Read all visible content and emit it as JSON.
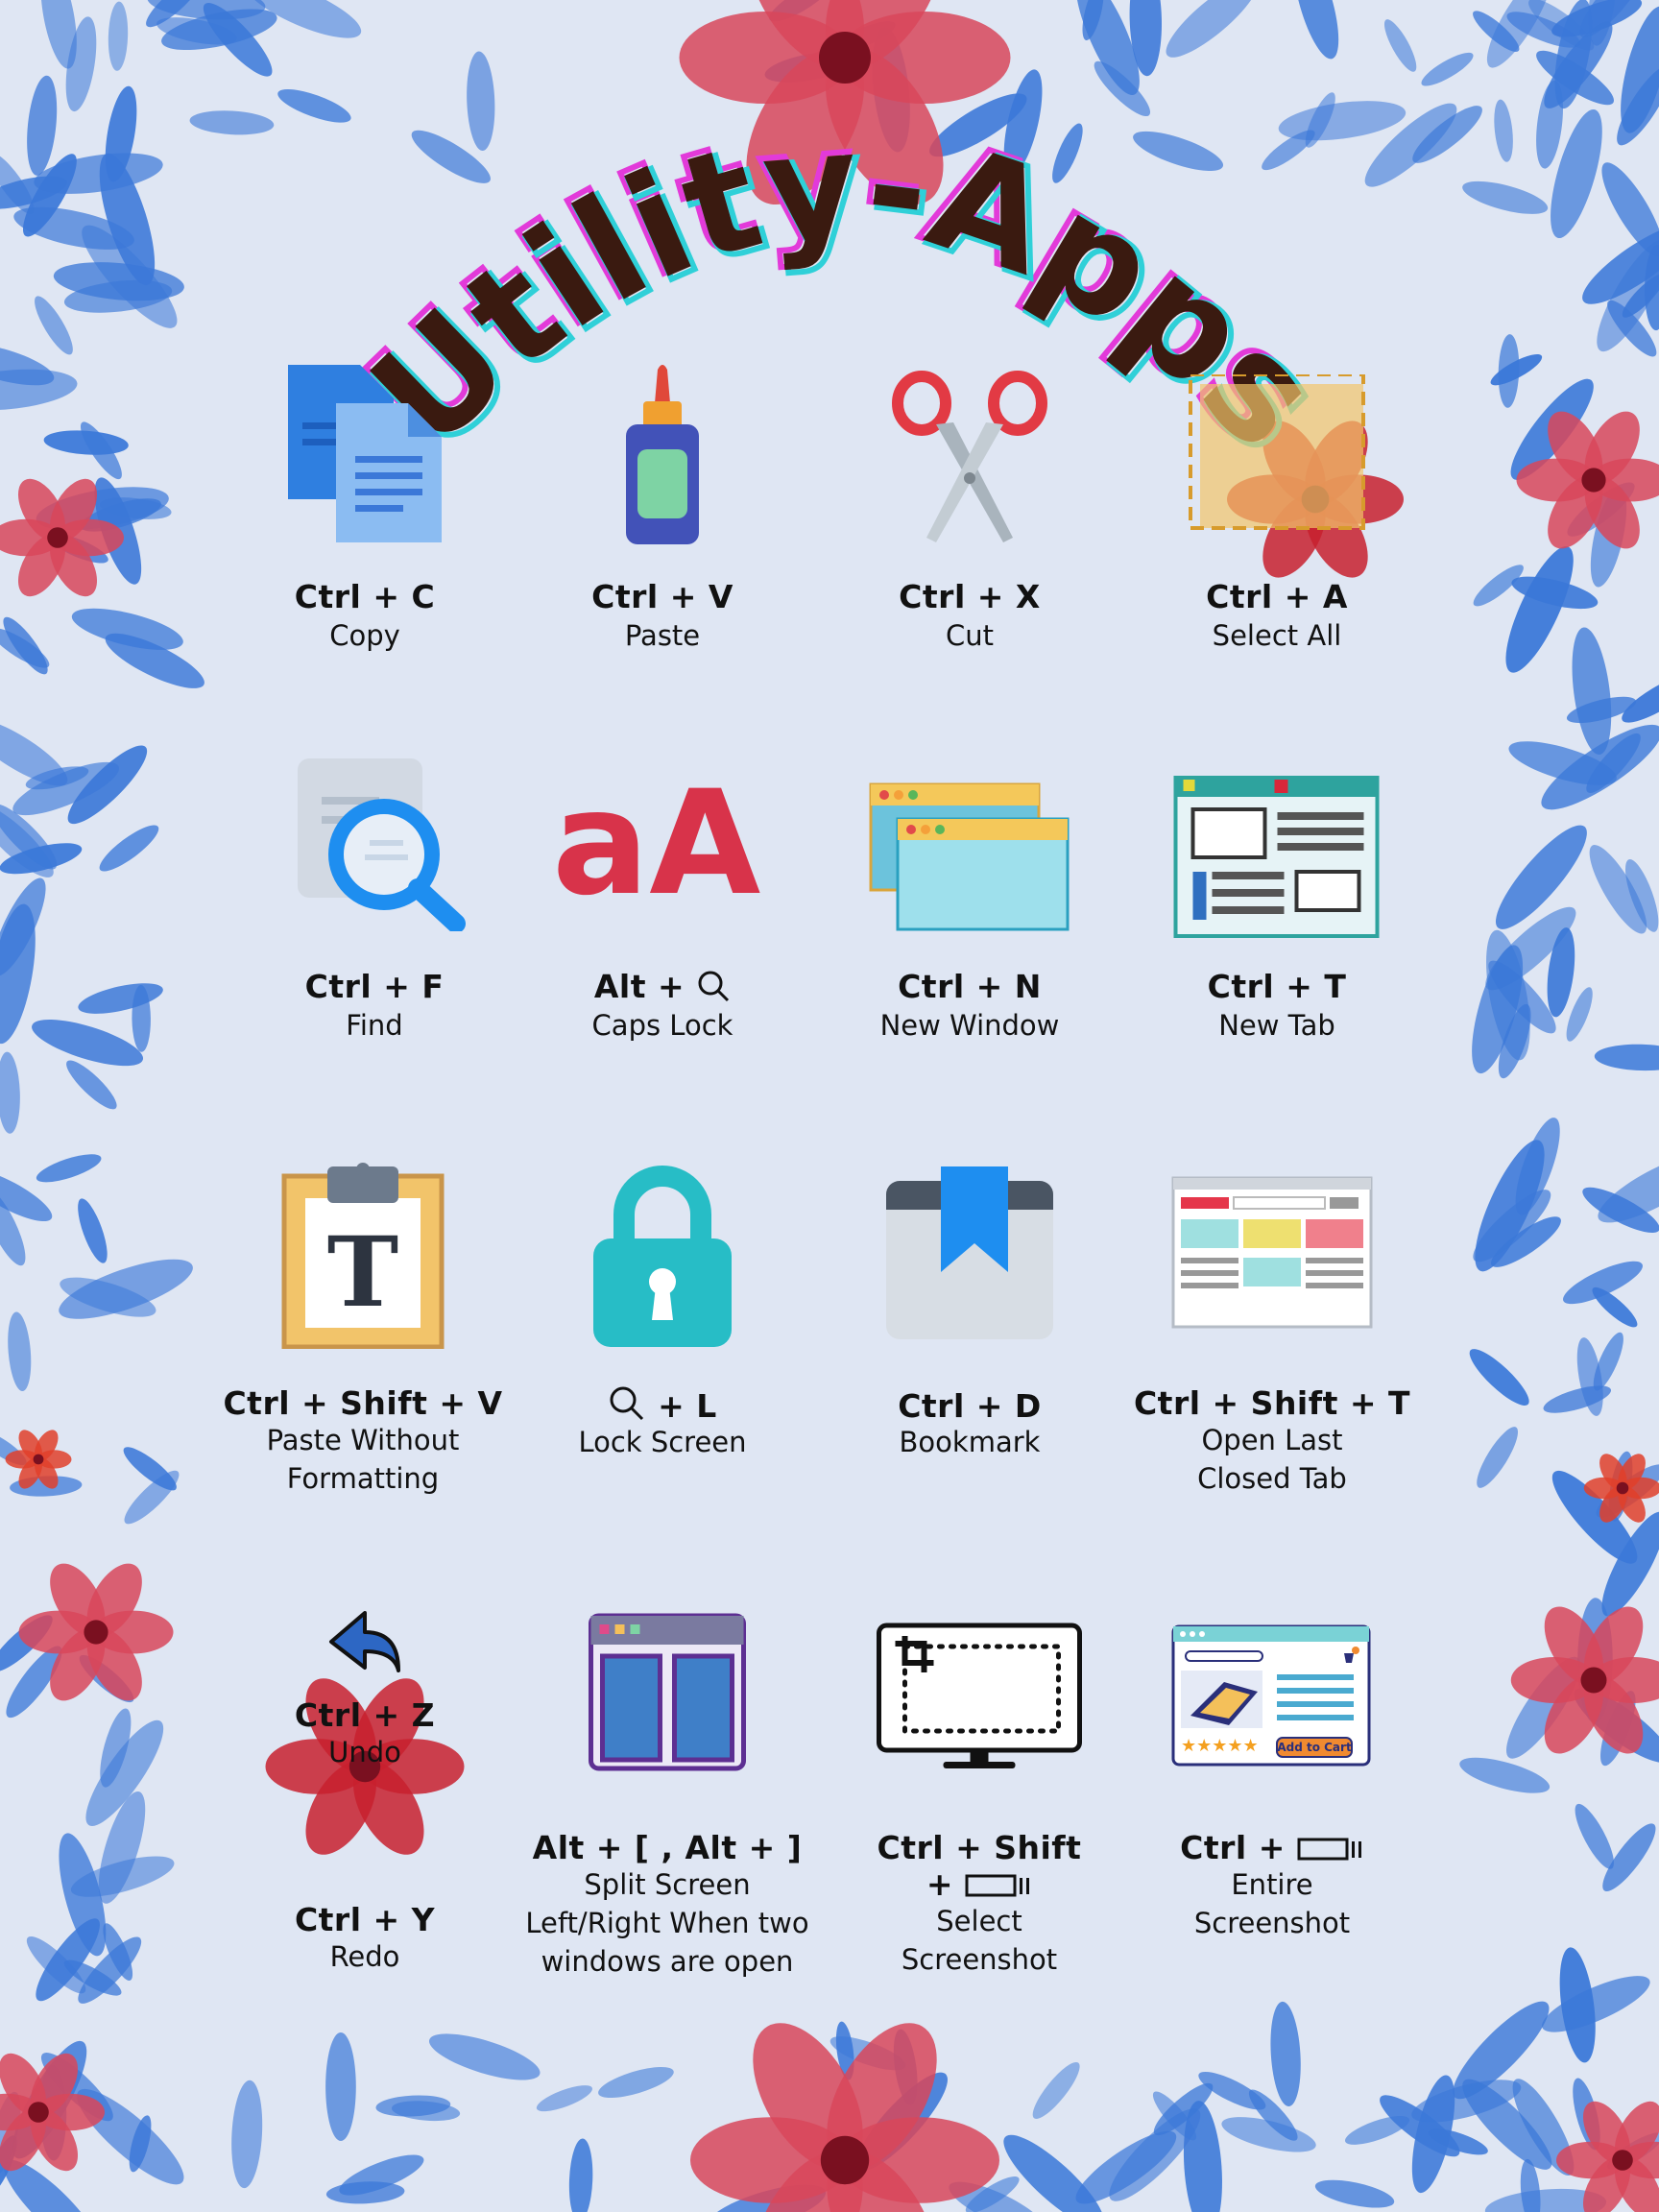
{
  "title": "Utility-Apps",
  "colors": {
    "background": "#dfe6f3",
    "title_fill": "#3a1a10",
    "title_glow_magenta": "#e23ad9",
    "title_glow_cyan": "#2fd0d8",
    "leaf_blue": "#3b78d8",
    "flower_red": "#d8465a"
  },
  "shortcuts": [
    {
      "icon": "copy-documents-icon",
      "keys": "Ctrl + C",
      "label": "Copy"
    },
    {
      "icon": "glue-bottle-icon",
      "keys": "Ctrl + V",
      "label": "Paste"
    },
    {
      "icon": "scissors-icon",
      "keys": "Ctrl + X",
      "label": "Cut"
    },
    {
      "icon": "select-box-icon",
      "keys": "Ctrl + A",
      "label": "Select All"
    },
    {
      "icon": "find-magnifier-icon",
      "keys": "Ctrl + F",
      "label": "Find"
    },
    {
      "icon": "case-aA-icon",
      "keys": "Alt +",
      "keys_icon": "search-icon",
      "label": "Caps Lock"
    },
    {
      "icon": "new-window-icon",
      "keys": "Ctrl + N",
      "label": "New Window"
    },
    {
      "icon": "new-tab-icon",
      "keys": "Ctrl + T",
      "label": "New Tab"
    },
    {
      "icon": "clipboard-text-icon",
      "keys": "Ctrl + Shift + V",
      "label_lines": [
        "Paste Without",
        "Formatting"
      ]
    },
    {
      "icon": "padlock-icon",
      "keys_icon": "search-icon",
      "keys": "+ L",
      "label": "Lock Screen"
    },
    {
      "icon": "bookmark-icon",
      "keys": "Ctrl + D",
      "label": "Bookmark"
    },
    {
      "icon": "browser-page-icon",
      "keys": "Ctrl + Shift + T",
      "label_lines": [
        "Open Last",
        "Closed Tab"
      ]
    },
    {
      "icon": "undo-arrow-icon",
      "keys": "Ctrl + Z",
      "label": "Undo"
    },
    {
      "icon": "split-screen-icon",
      "keys": "Alt + [ , Alt + ]",
      "label_lines": [
        "Split Screen",
        "Left/Right When two",
        "windows are open"
      ]
    },
    {
      "icon": "crop-monitor-icon",
      "keys_lines": [
        "Ctrl + Shift",
        "+"
      ],
      "keys_icon": "window-switch-key-icon",
      "label_lines": [
        "Select",
        "Screenshot"
      ]
    },
    {
      "icon": "shopping-page-icon",
      "keys": "Ctrl +",
      "keys_icon": "window-switch-key-icon",
      "label_lines": [
        "Entire",
        "Screenshot"
      ]
    },
    {
      "keys": "Ctrl + Y",
      "label": "Redo"
    }
  ],
  "shop_button": "Add to Cart"
}
